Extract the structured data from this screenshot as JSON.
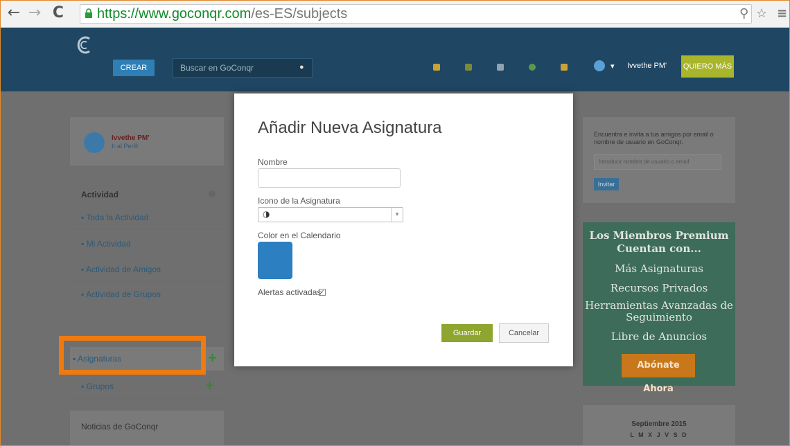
{
  "browser": {
    "url_secure": "https://www.goconqr.com",
    "url_path": "/es-ES/subjects",
    "back_icon": "arrow-left-icon",
    "forward_icon": "arrow-right-icon",
    "reload_icon": "reload-icon"
  },
  "header": {
    "create_label": "CREAR",
    "search_placeholder": "Buscar en GoConqr",
    "user_name": "Ivvethe PM'",
    "more_label": "QUIERO MÁS"
  },
  "left": {
    "profile_name": "Ivvethe PM'",
    "profile_link": "Ir al Perfil",
    "activity_title": "Actividad",
    "activity_items": [
      "Toda la Actividad",
      "Mi Actividad",
      "Actividad de Amigos",
      "Actividad de Grupos"
    ],
    "subjects_label": "Asignaturas",
    "groups_label": "Grupos",
    "news_title": "Noticias de GoConqr"
  },
  "right": {
    "invite_text": "Encuentra e invita a tus amigos por email o nombre de usuario en GoConqr.",
    "invite_placeholder": "Introducir nombre de usuario o email",
    "invite_button": "Invitar",
    "premium_title": "Los Miembros Premium Cuentan con...",
    "premium_items": [
      "Más Asignaturas",
      "Recursos Privados",
      "Herramientas Avanzadas de Seguimiento",
      "Libre de Anuncios"
    ],
    "premium_button": "Abónate Ahora",
    "calendar_title": "Septiembre 2015",
    "calendar_days": "L  M  X  J  V  S  D"
  },
  "modal": {
    "title": "Añadir Nueva Asignatura",
    "name_label": "Nombre",
    "name_value": "",
    "icon_label": "Icono de la Asignatura",
    "icon_value": "◑",
    "color_label": "Color en el Calendario",
    "color_value": "#2c7fc1",
    "alerts_label": "Alertas activadas",
    "alerts_checked": true,
    "save_label": "Guardar",
    "cancel_label": "Cancelar"
  },
  "annotation": {
    "highlight_color": "#ef7a10"
  }
}
